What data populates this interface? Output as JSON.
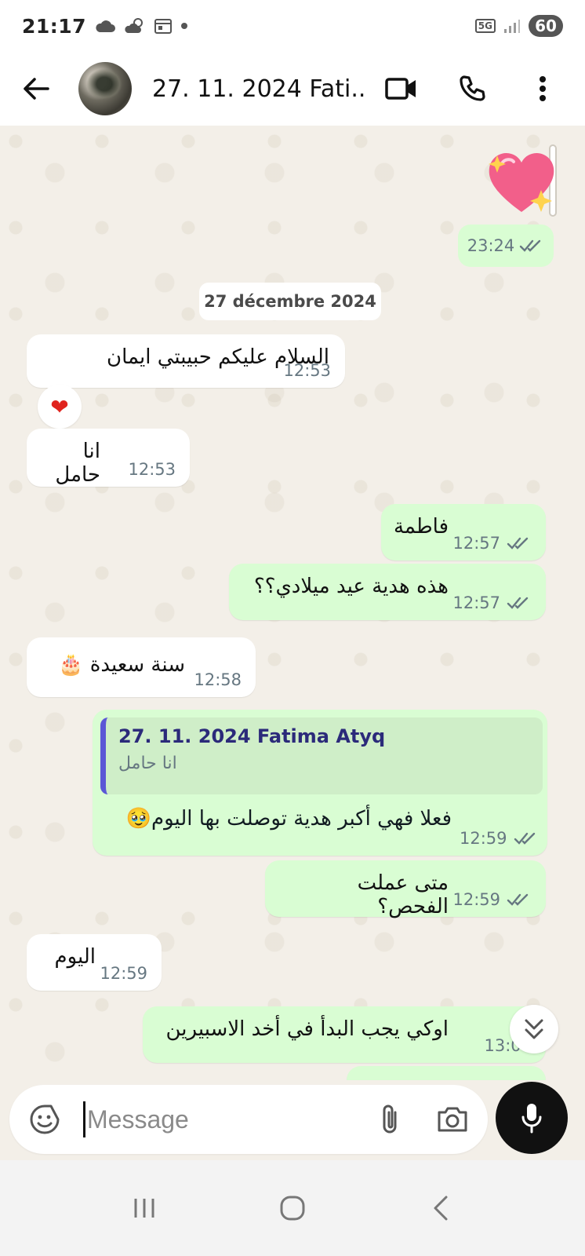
{
  "status_bar": {
    "time": "21:17",
    "battery": "60",
    "network": "5G"
  },
  "header": {
    "contact_name": "27. 11. 2024 Fati..."
  },
  "chat": {
    "sticker_time": "23:24",
    "date_chip": "27 décembre 2024",
    "messages": [
      {
        "dir": "in",
        "text": "السلام عليكم حبيبتي ايمان",
        "time": "12:53"
      },
      {
        "dir": "in",
        "text": "انا حامل",
        "time": "12:53"
      },
      {
        "dir": "out",
        "text": "فاطمة",
        "time": "12:57"
      },
      {
        "dir": "out",
        "text": "هذه هدية عيد ميلادي؟؟",
        "time": "12:57"
      },
      {
        "dir": "in",
        "text": "سنة سعيدة 🎂",
        "time": "12:58"
      },
      {
        "dir": "out",
        "text": "فعلا فهي أكبر هدية توصلت بها اليوم🥹",
        "time": "12:59"
      },
      {
        "dir": "out",
        "text": "متى عملت الفحص؟",
        "time": "12:59"
      },
      {
        "dir": "in",
        "text": "اليوم",
        "time": "12:59"
      },
      {
        "dir": "out",
        "text": "اوكي يجب البدأ في أخد الاسبيرين",
        "time": "13:00"
      }
    ],
    "reaction": "❤",
    "quote": {
      "author": "27. 11. 2024 Fatima Atyq",
      "text": "انا حامل"
    }
  },
  "composer": {
    "placeholder": "Message"
  }
}
